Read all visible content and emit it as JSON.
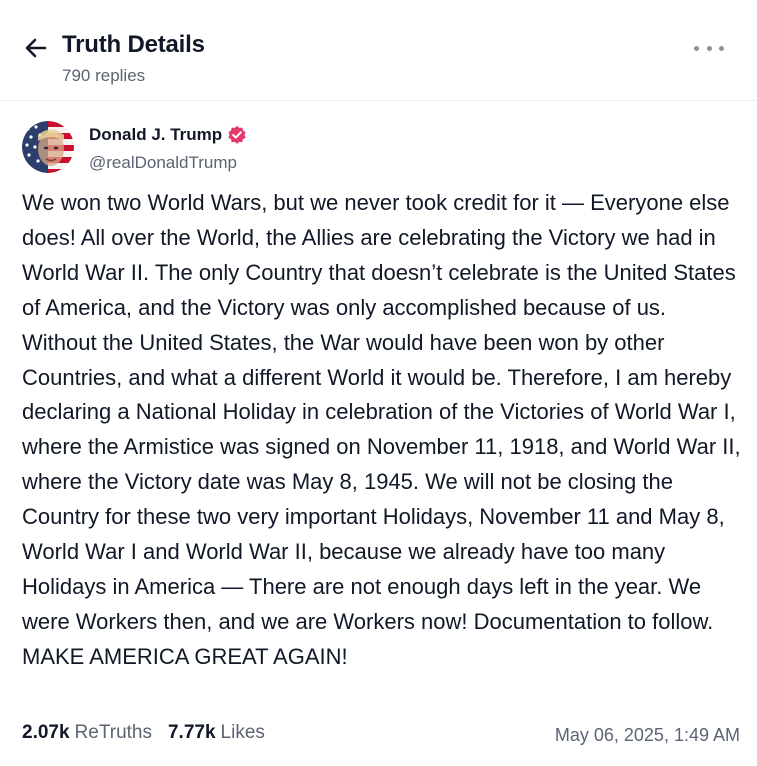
{
  "header": {
    "title": "Truth Details",
    "replies": "790 replies"
  },
  "post": {
    "author": {
      "display_name": "Donald J. Trump",
      "handle": "@realDonaldTrump",
      "verified": true
    },
    "text": "We won two World Wars, but we never took credit for it — Everyone else does! All over the World, the Allies are celebrating the Victory we had in World War II. The only Country that doesn’t celebrate is the United States of America, and the Victory was only accomplished because of us. Without the United States, the War would have been won by other Countries, and what a different World it would be. Therefore, I am hereby declaring a National Holiday in celebration of the Victories of World War I, where the Armistice was signed on November 11, 1918, and World War II, where the Victory date was May 8, 1945. We will not be closing the Country for these two very important Holidays, November 11 and May 8, World War I and World War II, because we already have too many Holidays in America — There are not enough days left in the year. We were Workers then, and we are Workers now! Documentation to follow. MAKE AMERICA GREAT AGAIN!",
    "retruths_count": "2.07k",
    "retruths_label": "ReTruths",
    "likes_count": "7.77k",
    "likes_label": "Likes",
    "timestamp": "May 06, 2025, 1:49 AM"
  },
  "icons": {
    "back": "arrow-left-icon",
    "more": "more-horizontal-icon",
    "verified": "verified-badge-icon"
  },
  "colors": {
    "verified_badge": "#e5396b",
    "text_primary": "#111827",
    "text_secondary": "#5b6472"
  }
}
